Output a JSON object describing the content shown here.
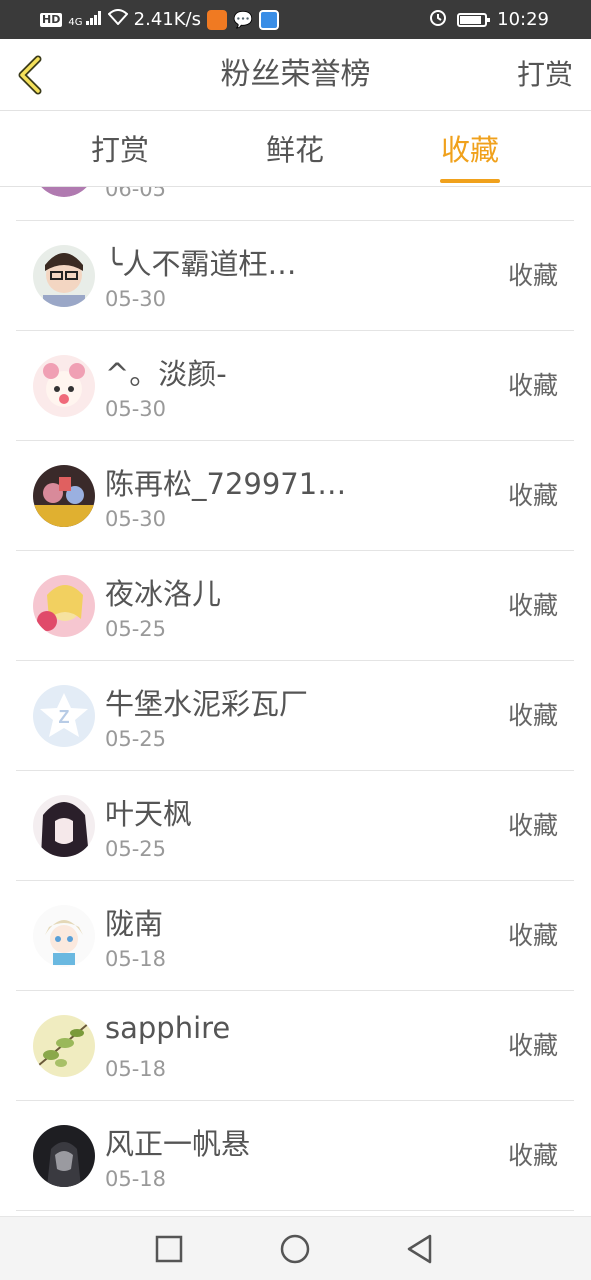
{
  "status_bar": {
    "hd_badge": "HD",
    "network": "4G",
    "speed": "2.41K/s",
    "time": "10:29",
    "battery_level": 0.85
  },
  "header": {
    "title": "粉丝荣誉榜",
    "action": "打赏",
    "back_icon": "chevron-left-icon",
    "accent_color": "#f0a11c"
  },
  "tabs": [
    {
      "label": "打赏",
      "active": false
    },
    {
      "label": "鲜花",
      "active": false
    },
    {
      "label": "收藏",
      "active": true
    }
  ],
  "list": {
    "partial_item": {
      "date": "06-05"
    },
    "items": [
      {
        "name": "╰人不霸道枉…",
        "date": "05-30",
        "action": "收藏"
      },
      {
        "name": "^。淡颜-",
        "date": "05-30",
        "action": "收藏"
      },
      {
        "name": "陈再松_729971…",
        "date": "05-30",
        "action": "收藏"
      },
      {
        "name": "夜冰洛儿",
        "date": "05-25",
        "action": "收藏"
      },
      {
        "name": "牛堡水泥彩瓦厂",
        "date": "05-25",
        "action": "收藏"
      },
      {
        "name": "叶天枫",
        "date": "05-25",
        "action": "收藏"
      },
      {
        "name": "陇南",
        "date": "05-18",
        "action": "收藏"
      },
      {
        "name": "sapphire",
        "date": "05-18",
        "action": "收藏"
      },
      {
        "name": "风正一帆悬",
        "date": "05-18",
        "action": "收藏"
      }
    ]
  },
  "nav_bar": {
    "icons": [
      "square-recent-apps-icon",
      "circle-home-icon",
      "triangle-back-icon"
    ]
  }
}
